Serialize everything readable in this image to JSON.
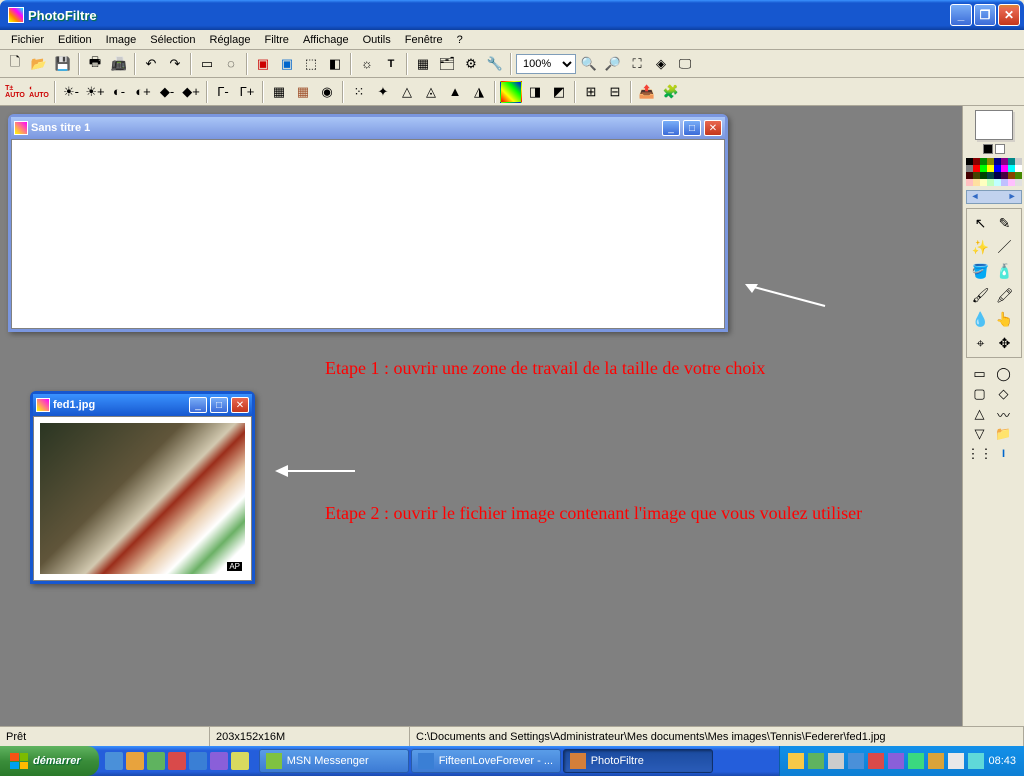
{
  "app": {
    "title": "PhotoFiltre"
  },
  "menus": [
    "Fichier",
    "Edition",
    "Image",
    "Sélection",
    "Réglage",
    "Filtre",
    "Affichage",
    "Outils",
    "Fenêtre",
    "?"
  ],
  "zoom": "100%",
  "windows": {
    "blank": {
      "title": "Sans titre 1"
    },
    "photo": {
      "title": "fed1.jpg"
    }
  },
  "annotations": {
    "step1": "Etape 1 : ouvrir une zone de travail de la taille de votre choix",
    "step2": "Etape 2 : ouvrir le fichier image contenant l'image que vous voulez utiliser"
  },
  "status": {
    "ready": "Prêt",
    "dims": "203x152x16M",
    "path": "C:\\Documents and Settings\\Administrateur\\Mes documents\\Mes images\\Tennis\\Federer\\fed1.jpg"
  },
  "taskbar": {
    "start": "démarrer",
    "tasks": [
      {
        "label": "MSN Messenger",
        "color": "#7fc241"
      },
      {
        "label": "FifteenLoveForever - ...",
        "color": "#3a7fd5"
      },
      {
        "label": "PhotoFiltre",
        "color": "#d47f3a",
        "active": true
      }
    ],
    "clock": "08:43"
  },
  "palette_colors": [
    "#000",
    "#800",
    "#080",
    "#880",
    "#008",
    "#808",
    "#088",
    "#ccc",
    "#808080",
    "#f00",
    "#0f0",
    "#ff0",
    "#00f",
    "#f0f",
    "#0ff",
    "#fff",
    "#400",
    "#440",
    "#040",
    "#044",
    "#004",
    "#404",
    "#840",
    "#480",
    "#ffc0c0",
    "#ffe0a0",
    "#ffffc0",
    "#c0ffc0",
    "#c0ffff",
    "#c0c0ff",
    "#ffc0ff",
    "#e0e0e0"
  ]
}
